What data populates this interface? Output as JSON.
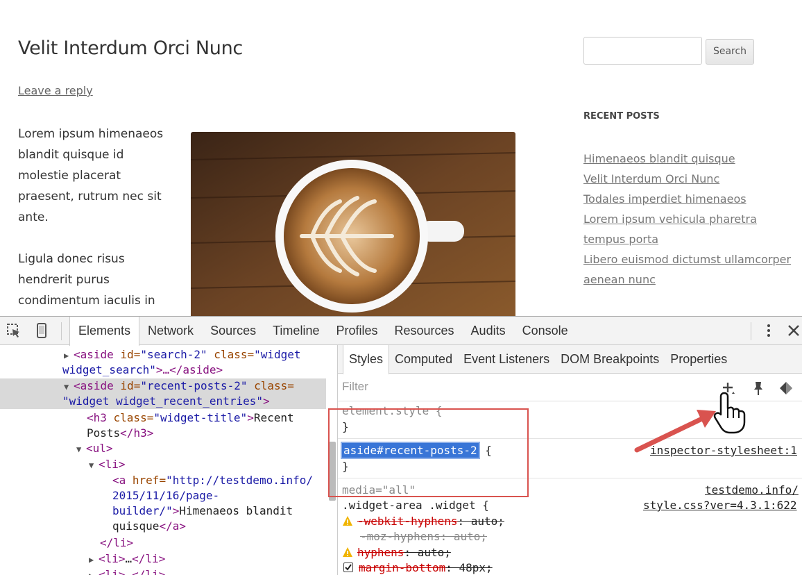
{
  "site": {
    "post_title": "Velit Interdum Orci Nunc",
    "reply_link": "Leave a reply",
    "paragraphs": [
      "Lorem ipsum himenaeos blandit quisque id molestie placerat praesent, rutrum nec sit ante.",
      "Ligula donec risus hendrerit purus condimentum iaculis in"
    ],
    "search_button": "Search",
    "search_value": "",
    "widget_title": "RECENT POSTS",
    "recent_posts": [
      "Himenaeos blandit quisque",
      "Velit Interdum Orci Nunc",
      "Todales imperdiet himenaeos",
      "Lorem ipsum vehicula pharetra tempus porta",
      "Libero euismod dictumst ullamcorper aenean nunc"
    ]
  },
  "devtools": {
    "tabs": [
      "Elements",
      "Network",
      "Sources",
      "Timeline",
      "Profiles",
      "Resources",
      "Audits",
      "Console"
    ],
    "active_tab": "Elements",
    "dom": {
      "l1": {
        "tag": "<aside ",
        "a1": "id=",
        "v1": "\"search-2\"",
        "a2": " class=",
        "v2": "\"widget"
      },
      "l1b": {
        "v": "widget_search\"",
        "rest": ">…</aside>"
      },
      "l2": {
        "tag": "<aside ",
        "a1": "id=",
        "v1": "\"recent-posts-2\"",
        "a2": " class="
      },
      "l2b": {
        "v": "\"widget widget_recent_entries\"",
        "rest": ">"
      },
      "l3": {
        "tag": "<h3 ",
        "a1": "class=",
        "v1": "\"widget-title\"",
        "close": ">",
        "text": "Recent"
      },
      "l3b": {
        "text": "Posts",
        "end": "</h3>"
      },
      "l4": {
        "tag": "<ul>"
      },
      "l5": {
        "tag": "<li>"
      },
      "l6": {
        "tag": "<a ",
        "a1": "href=",
        "v1": "\"http://testdemo.info/"
      },
      "l6b": {
        "v": "2015/11/16/page-"
      },
      "l6c": {
        "v": "builder/\"",
        "close": ">",
        "text": "Himenaeos blandit"
      },
      "l6d": {
        "text": "quisque",
        "end": "</a>"
      },
      "l7": {
        "tag": "</li>"
      },
      "l8": {
        "tag": "<li>",
        "text": "…",
        "end": "</li>"
      },
      "l9": {
        "tag": "<li>…</li>"
      }
    },
    "styles_tabs": [
      "Styles",
      "Computed",
      "Event Listeners",
      "DOM Breakpoints",
      "Properties"
    ],
    "active_styles_tab": "Styles",
    "filter_placeholder": "Filter",
    "element_style": "element.style {",
    "close_brace": "}",
    "selector": "aside#recent-posts-2",
    "selector_open": " {",
    "inspector_source": "inspector-stylesheet:1",
    "media": "media=\"all\"",
    "source1": "testdemo.info/",
    "source2": "style.css?ver=4.3.1:622",
    "rule2_selector": ".widget-area .widget {",
    "props": [
      {
        "name": "-webkit-hyphens",
        "value": ": auto;"
      },
      {
        "name": "-moz-hyphens",
        "value": ": auto;"
      },
      {
        "name": "hyphens",
        "value": ": auto;"
      },
      {
        "name": "margin-bottom",
        "value": ": 48px;"
      }
    ]
  },
  "colors": {
    "annotation": "#d9534f",
    "selection": "#3875d7"
  }
}
